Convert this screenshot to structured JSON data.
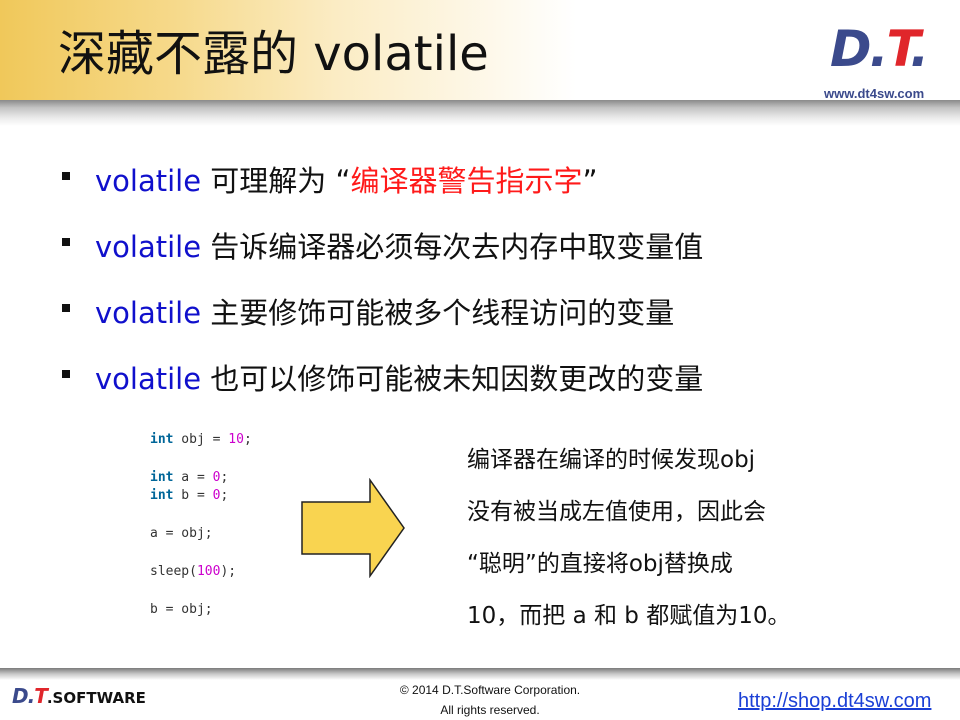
{
  "header": {
    "title": "深藏不露的 volatile",
    "logo_main": "D.",
    "logo_t": "T",
    "logo_dot": ".",
    "website": "www.dt4sw.com"
  },
  "bullets": [
    {
      "keyword": "volatile",
      "text": " 可理解为 “",
      "highlight": "编译器警告指示字",
      "tail": "”"
    },
    {
      "keyword": "volatile",
      "text": " 告诉编译器必须每次去内存中取变量值"
    },
    {
      "keyword": "volatile",
      "text": " 主要修饰可能被多个线程访问的变量"
    },
    {
      "keyword": "volatile",
      "text": " 也可以修饰可能被未知因数更改的变量"
    }
  ],
  "code": {
    "line1": {
      "type": "int",
      "rest_a": " obj = ",
      "num": "10",
      "rest_b": ";"
    },
    "line2": {
      "type": "int",
      "rest_a": " a = ",
      "num": "0",
      "rest_b": ";"
    },
    "line3": {
      "type": "int",
      "rest_a": " b = ",
      "num": "0",
      "rest_b": ";"
    },
    "line4": "a = obj;",
    "line5": {
      "rest_a": "sleep(",
      "num": "100",
      "rest_b": ");"
    },
    "line6": "b = obj;"
  },
  "explanation": [
    "编译器在编译的时候发现obj",
    "没有被当成左值使用，因此会",
    "“聪明”的直接将obj替换成",
    "10，而把 a 和 b 都赋值为10。"
  ],
  "footer": {
    "logo_main": "D.",
    "logo_t": "T",
    "logo_sw": ".SOFTWARE",
    "copyright_line1": "© 2014 D.T.Software Corporation.",
    "copyright_line2": "All rights reserved.",
    "link": "http://shop.dt4sw.com"
  },
  "colors": {
    "keyword": "#1010cc",
    "highlight": "#ff1a1a",
    "arrow_fill": "#f9d450",
    "brand_blue": "#3b4a8c",
    "brand_red": "#e0262b"
  }
}
